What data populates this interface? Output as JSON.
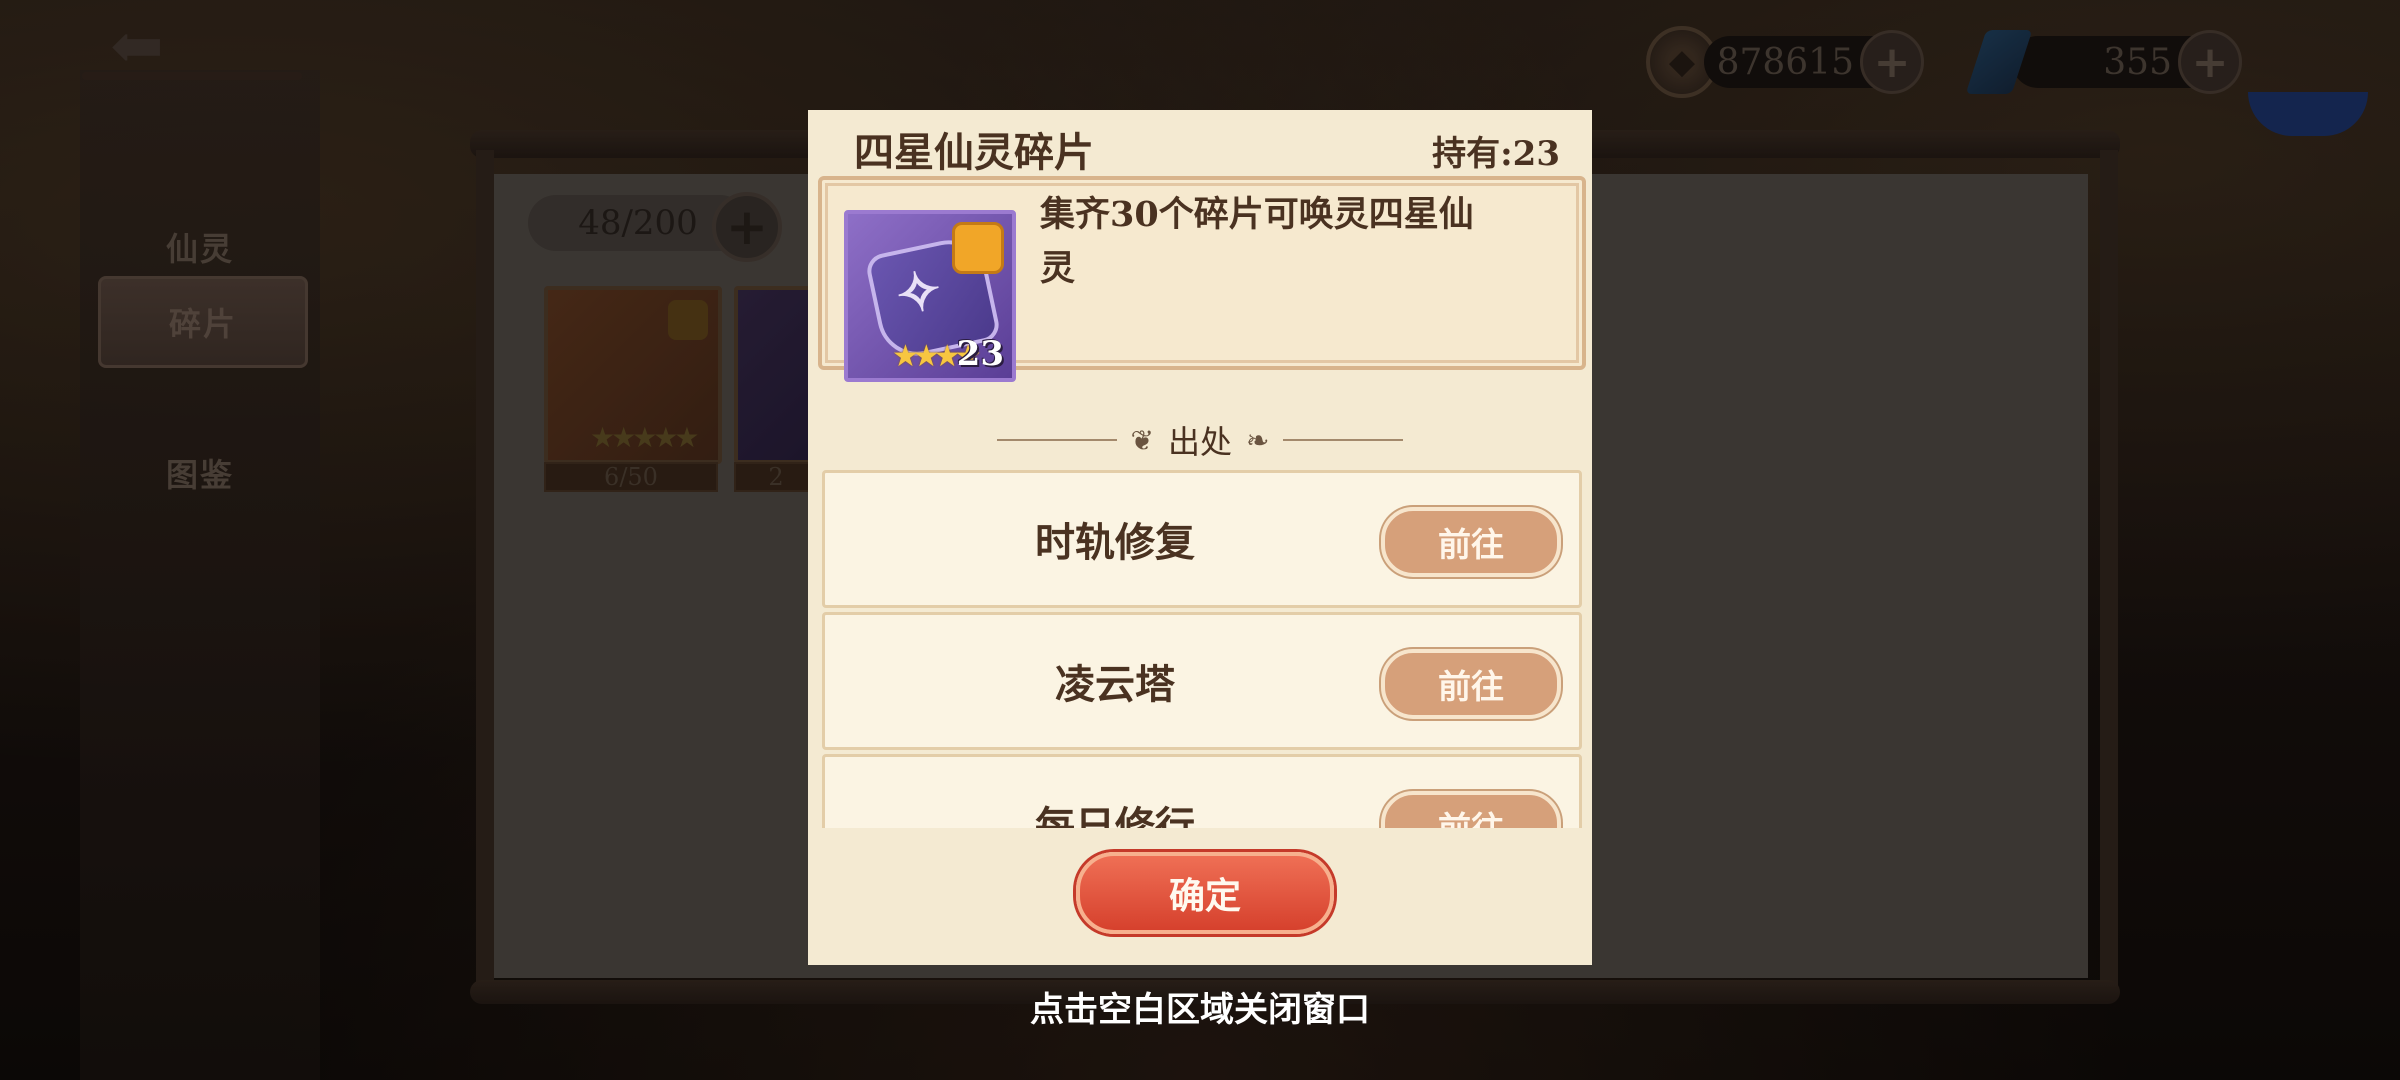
{
  "topbar": {
    "back_icon": "back-arrow-icon",
    "coins": "878615",
    "gems": "355",
    "plus_label": "+"
  },
  "sidebar": {
    "items": [
      {
        "label": "仙灵"
      },
      {
        "label": "碎片"
      },
      {
        "label": "图鉴"
      }
    ]
  },
  "inventory": {
    "count": "48/200",
    "plus_label": "+",
    "cards": [
      {
        "progress": "6/50"
      },
      {
        "progress": "2"
      }
    ]
  },
  "modal": {
    "title": "四星仙灵碎片",
    "held": "持有:23",
    "item": {
      "count": "23",
      "stars": "★★★★",
      "star_count": 4
    },
    "description": "集齐30个碎片可唤灵四星仙灵",
    "source_heading": "出处",
    "sources": [
      {
        "name": "时轨修复",
        "button": "前往"
      },
      {
        "name": "凌云塔",
        "button": "前往"
      },
      {
        "name": "每日修行",
        "button": "前往"
      }
    ],
    "confirm": "确定"
  },
  "hint": "点击空白区域关闭窗口",
  "colors": {
    "modal_bg": "#f4ead2",
    "go_button": "#d6a07a",
    "confirm_button": "#e0503b",
    "text_dark": "#4a3221"
  }
}
